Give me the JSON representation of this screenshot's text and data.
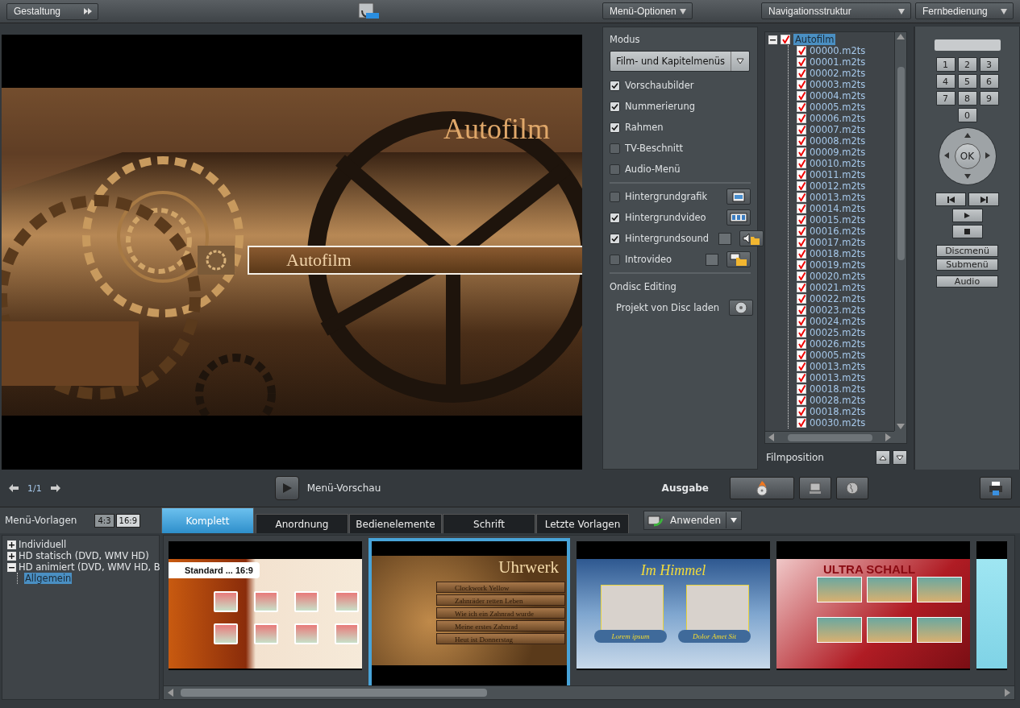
{
  "toolbar": {
    "design_button": "Gestaltung"
  },
  "preview": {
    "title": "Autofilm",
    "button_label": "Autofilm"
  },
  "menu_options": {
    "header": "Menü-Optionen",
    "mode_label": "Modus",
    "mode_value": "Film- und Kapitelmenüs",
    "checks": [
      {
        "label": "Vorschaubilder",
        "checked": true
      },
      {
        "label": "Nummerierung",
        "checked": true
      },
      {
        "label": "Rahmen",
        "checked": true
      },
      {
        "label": "TV-Beschnitt",
        "checked": false
      },
      {
        "label": "Audio-Menü",
        "checked": false
      }
    ],
    "backgrounds": [
      {
        "label": "Hintergrundgrafik",
        "checked": false,
        "kind": "image",
        "has_play": false
      },
      {
        "label": "Hintergrundvideo",
        "checked": true,
        "kind": "video",
        "has_play": false
      },
      {
        "label": "Hintergrundsound",
        "checked": true,
        "kind": "sound",
        "has_play": true
      },
      {
        "label": "Introvideo",
        "checked": false,
        "kind": "intro",
        "has_play": true
      }
    ],
    "ondisc_heading": "Ondisc Editing",
    "load_label": "Projekt von Disc laden"
  },
  "navigation": {
    "header": "Navigationsstruktur",
    "root": {
      "label": "Autofilm",
      "checked": true,
      "selected": true,
      "expanded": true,
      "children": [
        {
          "label": "00000.m2ts",
          "checked": true
        },
        {
          "label": "00001.m2ts",
          "checked": true
        },
        {
          "label": "00002.m2ts",
          "checked": true
        },
        {
          "label": "00003.m2ts",
          "checked": true
        },
        {
          "label": "00004.m2ts",
          "checked": true
        },
        {
          "label": "00005.m2ts",
          "checked": true
        },
        {
          "label": "00006.m2ts",
          "checked": true
        },
        {
          "label": "00007.m2ts",
          "checked": true
        },
        {
          "label": "00008.m2ts",
          "checked": true
        },
        {
          "label": "00009.m2ts",
          "checked": true
        },
        {
          "label": "00010.m2ts",
          "checked": true
        },
        {
          "label": "00011.m2ts",
          "checked": true
        },
        {
          "label": "00012.m2ts",
          "checked": true
        },
        {
          "label": "00013.m2ts",
          "checked": true
        },
        {
          "label": "00014.m2ts",
          "checked": true
        },
        {
          "label": "00015.m2ts",
          "checked": true
        },
        {
          "label": "00016.m2ts",
          "checked": true
        },
        {
          "label": "00017.m2ts",
          "checked": true
        },
        {
          "label": "00018.m2ts",
          "checked": true
        },
        {
          "label": "00019.m2ts",
          "checked": true
        },
        {
          "label": "00020.m2ts",
          "checked": true
        },
        {
          "label": "00021.m2ts",
          "checked": true
        },
        {
          "label": "00022.m2ts",
          "checked": true
        },
        {
          "label": "00023.m2ts",
          "checked": true
        },
        {
          "label": "00024.m2ts",
          "checked": true
        },
        {
          "label": "00025.m2ts",
          "checked": true
        },
        {
          "label": "00026.m2ts",
          "checked": true
        },
        {
          "label": "00005.m2ts",
          "checked": true
        },
        {
          "label": "00013.m2ts",
          "checked": true
        },
        {
          "label": "00013.m2ts",
          "checked": true
        },
        {
          "label": "00018.m2ts",
          "checked": true
        },
        {
          "label": "00028.m2ts",
          "checked": true
        },
        {
          "label": "00018.m2ts",
          "checked": true
        },
        {
          "label": "00030.m2ts",
          "checked": true
        }
      ]
    },
    "film_position_label": "Filmposition"
  },
  "remote": {
    "header": "Fernbedienung",
    "keys": [
      "1",
      "2",
      "3",
      "4",
      "5",
      "6",
      "7",
      "8",
      "9",
      "0"
    ],
    "ok": "OK",
    "menu_buttons": [
      "Discmenü",
      "Submenü",
      "Audio"
    ]
  },
  "preview_bar": {
    "page": "1/1",
    "preview_label": "Menü-Vorschau",
    "output_label": "Ausgabe"
  },
  "templates": {
    "label": "Menü-Vorlagen",
    "aspects": [
      {
        "label": "4:3",
        "selected": false
      },
      {
        "label": "16:9",
        "selected": true
      }
    ],
    "tabs": [
      {
        "label": "Komplett",
        "selected": true
      },
      {
        "label": "Anordnung",
        "selected": false
      },
      {
        "label": "Bedienelemente",
        "selected": false
      },
      {
        "label": "Schrift",
        "selected": false
      },
      {
        "label": "Letzte Vorlagen",
        "selected": false
      }
    ],
    "apply_button": "Anwenden",
    "tree": [
      {
        "label": "Individuell",
        "expanded": false
      },
      {
        "label": "HD statisch (DVD, WMV HD)",
        "expanded": false
      },
      {
        "label": "HD animiert (DVD, WMV HD, B",
        "expanded": true,
        "children": [
          {
            "label": "Allgemein",
            "selected": true
          }
        ]
      }
    ],
    "thumbnails": [
      {
        "kind": "standard",
        "title": "Standard ... 16:9",
        "selected": false
      },
      {
        "kind": "clock",
        "title": "Uhrwerk",
        "selected": true,
        "lines": [
          "Clockwork Yellow",
          "Zahnräder retten Leben",
          "Wie ich ein Zahnrad wurde",
          "Meine erstes Zahnrad",
          "Heut ist Donnerstag"
        ]
      },
      {
        "kind": "sky",
        "title": "Im Himmel",
        "selected": false,
        "lines": [
          "Lorem ipsum",
          "Dolor Amet Sit"
        ]
      },
      {
        "kind": "red",
        "title": "ULTRA SCHALL",
        "selected": false
      },
      {
        "kind": "cyan",
        "selected": false
      }
    ]
  }
}
